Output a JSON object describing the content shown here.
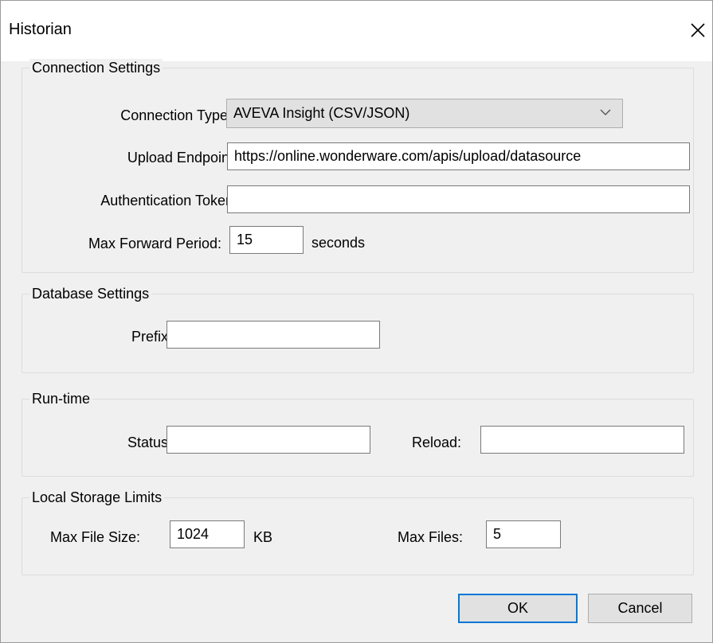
{
  "window": {
    "title": "Historian"
  },
  "connection": {
    "legend": "Connection Settings",
    "type_label": "Connection Type:",
    "type_value": "AVEVA Insight (CSV/JSON)",
    "endpoint_label": "Upload Endpoint:",
    "endpoint_value": "https://online.wonderware.com/apis/upload/datasource",
    "token_label": "Authentication Token:",
    "token_value": "",
    "forward_label": "Max Forward Period:",
    "forward_value": "15",
    "forward_unit": "seconds"
  },
  "database": {
    "legend": "Database Settings",
    "prefix_label": "Prefix:",
    "prefix_value": ""
  },
  "runtime": {
    "legend": "Run-time",
    "status_label": "Status:",
    "status_value": "",
    "reload_label": "Reload:",
    "reload_value": ""
  },
  "storage": {
    "legend": "Local Storage Limits",
    "file_size_label": "Max File Size:",
    "file_size_value": "1024",
    "file_size_unit": "KB",
    "max_files_label": "Max Files:",
    "max_files_value": "5"
  },
  "buttons": {
    "ok": "OK",
    "cancel": "Cancel"
  },
  "icons": {
    "close": "close-icon",
    "dropdown": "chevron-down-icon"
  }
}
